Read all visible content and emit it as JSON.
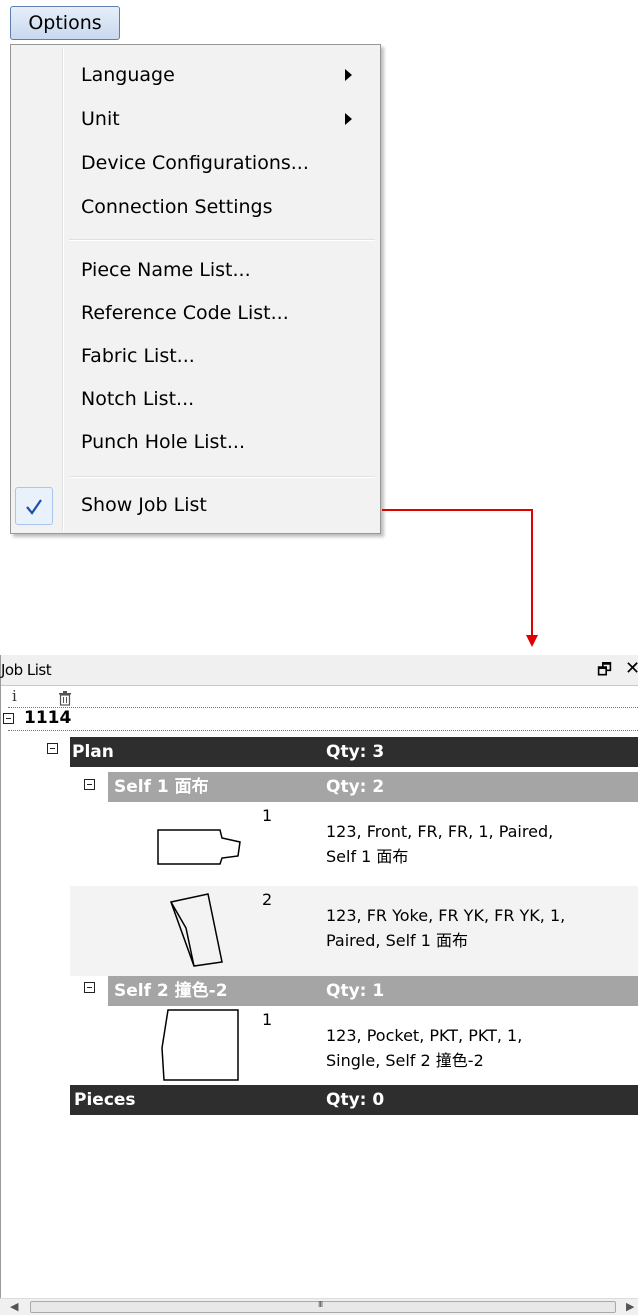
{
  "menu_button": {
    "label": "Options"
  },
  "options_menu": {
    "items": [
      {
        "label": "Language",
        "submenu": true
      },
      {
        "label": "Unit",
        "submenu": true
      },
      {
        "label": "Device Configurations..."
      },
      {
        "label": "Connection Settings"
      },
      {
        "label": "Piece Name List..."
      },
      {
        "label": "Reference Code List..."
      },
      {
        "label": "Fabric List..."
      },
      {
        "label": "Notch List..."
      },
      {
        "label": "Punch Hole List..."
      },
      {
        "label": "Show Job List",
        "checked": true
      }
    ]
  },
  "job_list": {
    "title": "Job List",
    "root": {
      "label": "1114"
    },
    "plan": {
      "label": "Plan",
      "qty": "Qty: 3"
    },
    "groups": [
      {
        "label": "Self 1 面布",
        "qty": "Qty: 2"
      },
      {
        "label": "Self 2 撞色-2",
        "qty": "Qty: 1"
      }
    ],
    "pieces": [
      {
        "number": "1",
        "desc_line1": "123, Front, FR, FR, 1, Paired,",
        "desc_line2": "Self 1 面布"
      },
      {
        "number": "2",
        "desc_line1": "123, FR Yoke, FR YK, FR YK, 1,",
        "desc_line2": "Paired, Self 1 面布"
      },
      {
        "number": "1",
        "desc_line1": "123, Pocket, PKT, PKT, 1,",
        "desc_line2": "Single, Self 2 撞色-2"
      }
    ],
    "pieces_row": {
      "label": "Pieces",
      "qty": "Qty: 0"
    }
  },
  "colors": {
    "connector": "#e00000",
    "dark_row": "#2e2e2e",
    "gray_row": "#a5a5a5",
    "check": "#1f4fa8"
  }
}
